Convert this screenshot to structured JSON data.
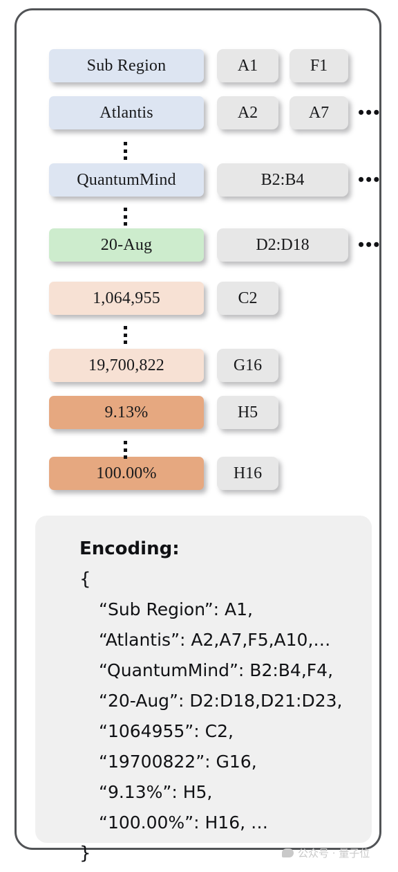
{
  "rows": [
    {
      "value": "Sub Region",
      "color": "blue",
      "tags": [
        "A1",
        "F1"
      ],
      "more": false,
      "wide": false
    },
    {
      "value": "Atlantis",
      "color": "blue",
      "tags": [
        "A2",
        "A7"
      ],
      "more": true,
      "wide": false
    },
    {
      "value": "QuantumMind",
      "color": "blue",
      "tags": [
        "B2:B4"
      ],
      "more": true,
      "wide": true
    },
    {
      "value": "20-Aug",
      "color": "green",
      "tags": [
        "D2:D18"
      ],
      "more": true,
      "wide": true
    },
    {
      "value": "1,064,955",
      "color": "orange-l",
      "tags": [
        "C2"
      ],
      "more": false,
      "wide": false
    },
    {
      "value": "19,700,822",
      "color": "orange-l",
      "tags": [
        "G16"
      ],
      "more": false,
      "wide": false
    },
    {
      "value": "9.13%",
      "color": "orange-d",
      "tags": [
        "H5"
      ],
      "more": false,
      "wide": false
    },
    {
      "value": "100.00%",
      "color": "orange-d",
      "tags": [
        "H16"
      ],
      "more": false,
      "wide": false
    }
  ],
  "ellipsis": {
    "horizontal": "•••",
    "vertical_separator_positions": [
      1,
      2,
      4,
      6
    ]
  },
  "encoding": {
    "title": "Encoding:",
    "open_brace": "{",
    "close_brace": "}",
    "lines": [
      "“Sub Region”: A1,",
      "“Atlantis”: A2,A7,F5,A10,…",
      "“QuantumMind”: B2:B4,F4,",
      "“20-Aug”: D2:D18,D21:D23,",
      "“1064955”: C2,",
      "“19700822”: G16,",
      "“9.13%”: H5,",
      "“100.00%”: H16,  …"
    ]
  },
  "watermark": {
    "text": "公众号 · 量子位"
  },
  "colors": {
    "blue": "#dde5f2",
    "green": "#cdeccd",
    "orange_light": "#f7e1d4",
    "orange_dark": "#e6a880",
    "tag_grey": "#e7e7e7",
    "panel_grey": "#f0f0f0",
    "card_border": "#515356"
  }
}
